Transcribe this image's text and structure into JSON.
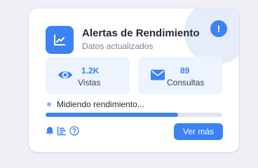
{
  "card": {
    "title": "Alertas de Rendimiento",
    "subtitle": "Datos actualizados",
    "alert_badge": "!"
  },
  "stats": [
    {
      "value": "1.2K",
      "label": "Vistas",
      "icon": "eye-icon"
    },
    {
      "value": "89",
      "label": "Consultas",
      "icon": "envelope-icon"
    }
  ],
  "status": {
    "text": "Midiendo rendimiento...",
    "progress": 0.75
  },
  "footer": {
    "icons": [
      "bell-icon",
      "bar-chart-icon",
      "help-icon"
    ],
    "more_button": "Ver más"
  },
  "colors": {
    "accent": "#3b82f6",
    "stat_background": "#eef4ff",
    "track": "#e3e5ea"
  }
}
